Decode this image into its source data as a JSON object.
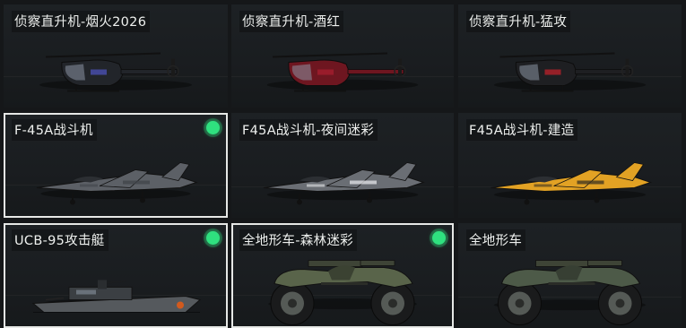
{
  "vehicles": [
    {
      "label": "侦察直升机-烟火2026",
      "kind": "helicopter",
      "paint": "#22252a",
      "accent": "#4a4fb0",
      "selected": false,
      "owned": false
    },
    {
      "label": "侦察直升机-酒红",
      "kind": "helicopter",
      "paint": "#6e1620",
      "accent": "#a41e2e",
      "selected": false,
      "owned": false
    },
    {
      "label": "侦察直升机-猛攻",
      "kind": "helicopter",
      "paint": "#1e1f22",
      "accent": "#b3202a",
      "selected": false,
      "owned": false
    },
    {
      "label": "F-45A战斗机",
      "kind": "jet",
      "paint": "#5c6066",
      "accent": "#40444a",
      "selected": true,
      "owned": true
    },
    {
      "label": "F45A战斗机-夜间迷彩",
      "kind": "jet",
      "paint": "#6a6e74",
      "accent": "#e4e6e8",
      "selected": false,
      "owned": false
    },
    {
      "label": "F45A战斗机-建造",
      "kind": "jet",
      "paint": "#e2a224",
      "accent": "#3a3120",
      "selected": false,
      "owned": false
    },
    {
      "label": "UCB-95攻击艇",
      "kind": "boat",
      "paint": "#55595d",
      "accent": "#d25a1e",
      "selected": true,
      "owned": true
    },
    {
      "label": "全地形车-森林迷彩",
      "kind": "atv",
      "paint": "#59644a",
      "accent": "#3b4232",
      "selected": true,
      "owned": true
    },
    {
      "label": "全地形车",
      "kind": "atv",
      "paint": "#4d5a48",
      "accent": "#373f33",
      "selected": false,
      "owned": false
    }
  ],
  "owned_color": "#2fe07f",
  "selected_border_color": "#e6e8e6"
}
